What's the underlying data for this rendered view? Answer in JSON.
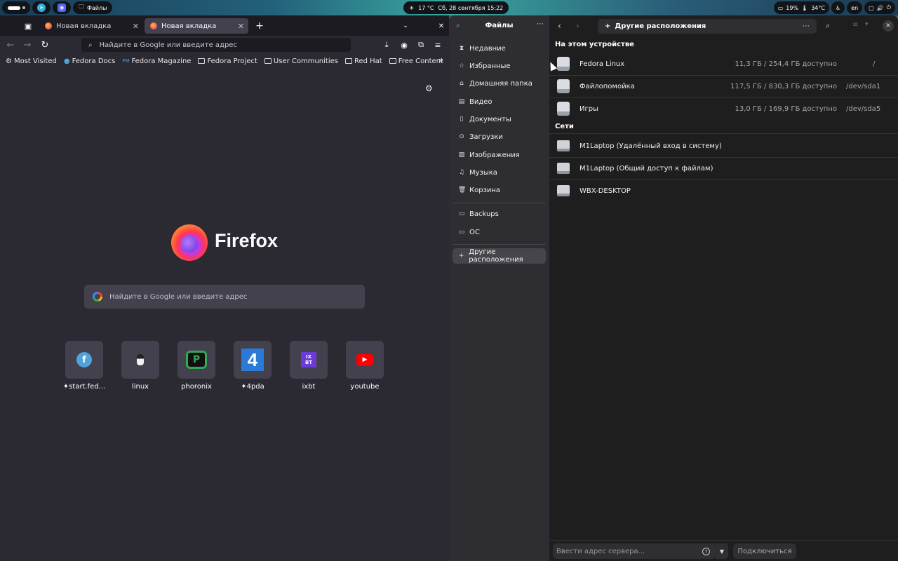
{
  "topbar": {
    "files_app_label": "Файлы",
    "weather": "17 °C",
    "clock": "Сб, 28 сентября 15:22",
    "battery": "19%",
    "temperature": "34°C",
    "language": "en"
  },
  "firefox": {
    "tabs": [
      {
        "label": "Новая вкладка"
      },
      {
        "label": "Новая вкладка"
      }
    ],
    "urlbar_placeholder": "Найдите в Google или введите адрес",
    "bookmarks": [
      {
        "label": "Most Visited",
        "icon": "gear-icon"
      },
      {
        "label": "Fedora Docs",
        "icon": "fedora-icon"
      },
      {
        "label": "Fedora Magazine",
        "icon": "fm-icon"
      },
      {
        "label": "Fedora Project",
        "icon": "folder-icon"
      },
      {
        "label": "User Communities",
        "icon": "folder-icon"
      },
      {
        "label": "Red Hat",
        "icon": "folder-icon"
      },
      {
        "label": "Free Content",
        "icon": "folder-icon"
      }
    ],
    "wordmark": "Firefox",
    "search_placeholder": "Найдите в Google или введите адрес",
    "top_sites": [
      {
        "label": "start.fed...",
        "pinned": true
      },
      {
        "label": "linux",
        "pinned": false
      },
      {
        "label": "phoronix",
        "pinned": false
      },
      {
        "label": "4pda",
        "pinned": true
      },
      {
        "label": "ixbt",
        "pinned": false
      },
      {
        "label": "youtube",
        "pinned": false
      }
    ]
  },
  "files": {
    "sidebar_title": "Файлы",
    "sidebar_items": [
      {
        "label": "Недавние",
        "icon": "recent-icon"
      },
      {
        "label": "Избранные",
        "icon": "star-icon"
      },
      {
        "label": "Домашняя папка",
        "icon": "home-icon"
      },
      {
        "label": "Видео",
        "icon": "video-icon"
      },
      {
        "label": "Документы",
        "icon": "documents-icon"
      },
      {
        "label": "Загрузки",
        "icon": "downloads-icon"
      },
      {
        "label": "Изображения",
        "icon": "pictures-icon"
      },
      {
        "label": "Музыка",
        "icon": "music-icon"
      },
      {
        "label": "Корзина",
        "icon": "trash-icon"
      }
    ],
    "bookmark_items": [
      {
        "label": "Backups"
      },
      {
        "label": "OC"
      }
    ],
    "other_locations_label": "Другие расположения",
    "path_label": "Другие расположения",
    "section_device": "На этом устройстве",
    "devices": [
      {
        "name": "Fedora Linux",
        "size": "11,3 ГБ / 254,4 ГБ доступно",
        "dev": "/"
      },
      {
        "name": "Файлопомойка",
        "size": "117,5 ГБ / 830,3 ГБ доступно",
        "dev": "/dev/sda1"
      },
      {
        "name": "Игры",
        "size": "13,0 ГБ / 169,9 ГБ доступно",
        "dev": "/dev/sda5"
      }
    ],
    "section_networks": "Сети",
    "networks": [
      {
        "name": "M1Laptop (Удалённый вход в систему)"
      },
      {
        "name": "M1Laptop (Общий доступ к файлам)"
      },
      {
        "name": "WBX-DESKTOP"
      }
    ],
    "server_placeholder": "Ввести адрес сервера...",
    "connect_label": "Подключиться"
  }
}
